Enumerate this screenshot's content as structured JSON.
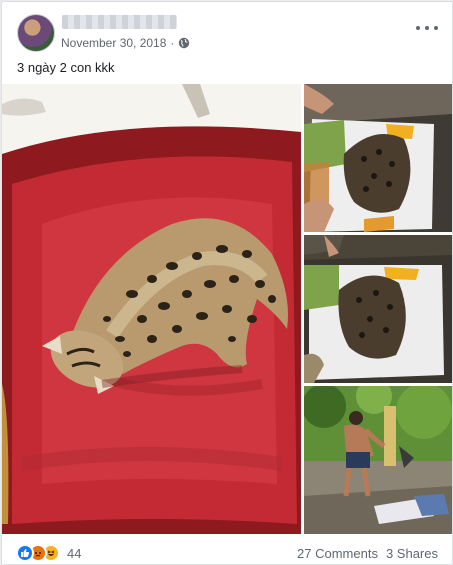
{
  "post": {
    "date": "November 30, 2018",
    "separator": "·",
    "privacy_icon": "globe-icon",
    "text": "3 ngày 2 con kkk"
  },
  "footer": {
    "reaction_count": "44",
    "reaction_icons": [
      "like-icon",
      "angry-icon",
      "haha-icon"
    ],
    "comments": "27 Comments",
    "shares": "3 Shares"
  },
  "colors": {
    "facebook_blue": "#1877f2",
    "meta_text": "#616770",
    "body_text": "#1c1e21"
  }
}
